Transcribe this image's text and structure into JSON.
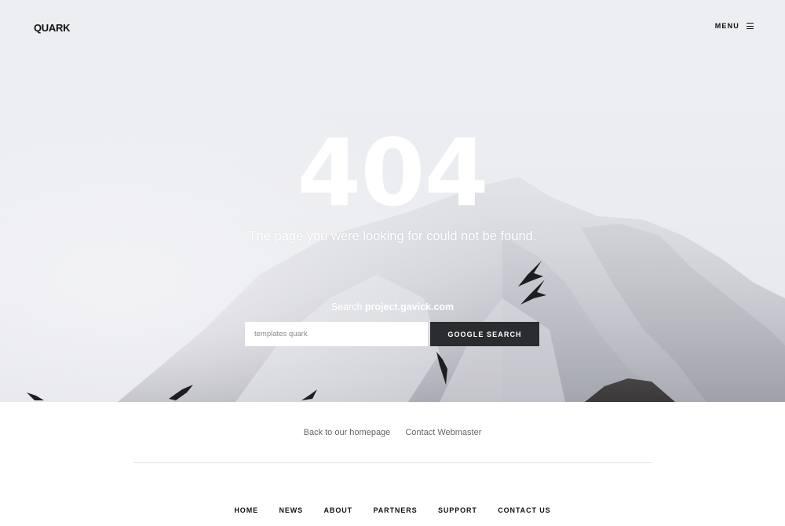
{
  "header": {
    "logo": "QUARK",
    "menu_label": "MENU",
    "menu_icon": "hamburger-icon"
  },
  "hero": {
    "error_code": "404",
    "message": "The page you were looking for could not be found.",
    "search_prefix": "Search",
    "search_site": "project.gavick.com"
  },
  "search": {
    "value": "",
    "placeholder": "templates quark",
    "button_label": "GOOGLE SEARCH"
  },
  "links": {
    "homepage": "Back to our homepage",
    "contact": "Contact Webmaster"
  },
  "footer": {
    "nav": [
      "HOME",
      "NEWS",
      "ABOUT",
      "PARTNERS",
      "SUPPORT",
      "CONTACT US"
    ]
  },
  "colors": {
    "button_bg": "#2b2c2f",
    "hero_sky": "#eeeff3",
    "text_dark": "#111111"
  }
}
